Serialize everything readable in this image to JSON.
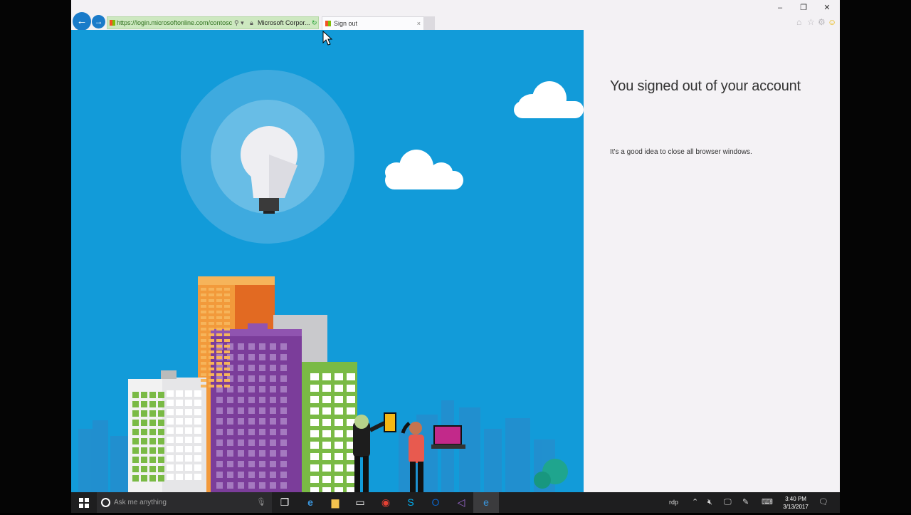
{
  "browser": {
    "url": "https://login.microsoftonline.com/contosc",
    "url_controls": "⚲ ▾",
    "cert_label": "Microsoft Corpor...",
    "tab_title": "Sign out",
    "tab_close": "×",
    "back_icon": "arrow-left-icon",
    "forward_icon": "arrow-right-icon"
  },
  "window_controls": {
    "minimize": "–",
    "maximize": "❐",
    "close": "✕"
  },
  "toolbar_icons": {
    "home": "⌂",
    "favorites": "☆",
    "settings": "⚙",
    "smile": "☺"
  },
  "page": {
    "title": "You signed out of your account",
    "message": "It's a good idea to close all browser windows."
  },
  "taskbar": {
    "start_icon": "windows-logo-icon",
    "search_placeholder": "Ask me anything",
    "apps": [
      "task-view",
      "edge",
      "file-explorer",
      "terminal",
      "chrome",
      "skype",
      "outlook",
      "visual-studio",
      "internet-explorer"
    ],
    "rdp_label": "rdp",
    "time": "3:40 PM",
    "date": "3/13/2017"
  },
  "colors": {
    "hero_sky": "#129bd9",
    "accent_blue": "#1a7bc9",
    "address_bar_green": "#cde8c0",
    "taskbar": "#1e1e1f"
  }
}
